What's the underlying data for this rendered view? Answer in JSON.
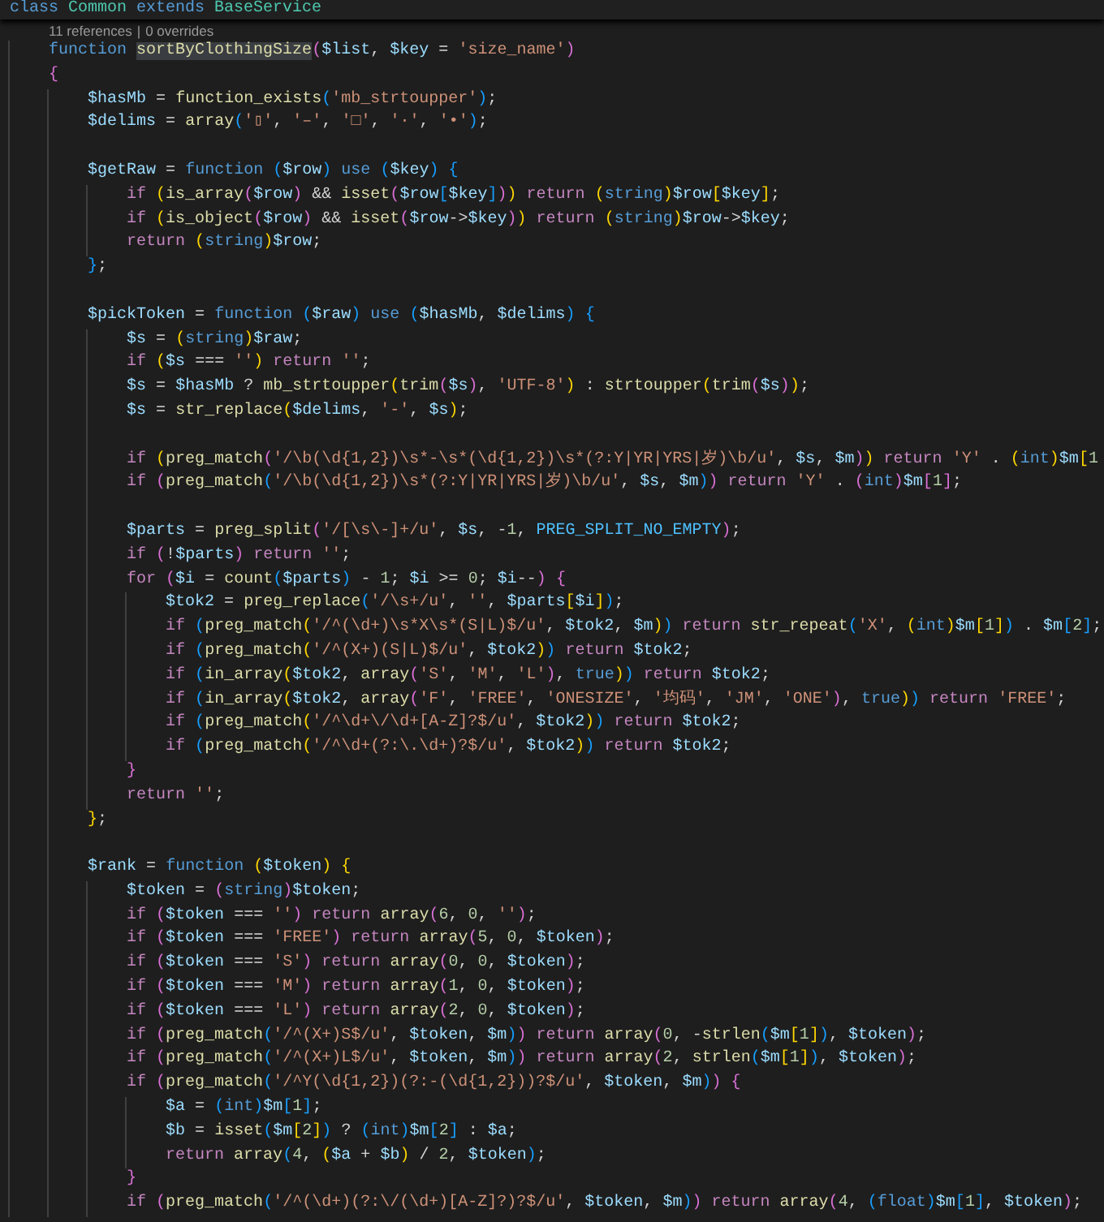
{
  "sticky_header": {
    "segments": [
      {
        "kind": "storage",
        "text": "class"
      },
      {
        "kind": "class",
        "text": " Common"
      },
      {
        "kind": "storage",
        "text": " extends"
      },
      {
        "kind": "class",
        "text": " BaseService"
      }
    ]
  },
  "codelens": {
    "references": "11 references",
    "separator": "|",
    "overrides": "0 overrides"
  },
  "lines": [
    {
      "blank_before": false,
      "segments": [
        {
          "kind": "storage",
          "text": "    function"
        },
        {
          "kind": "selection",
          "text": " sortByClothingSize"
        },
        {
          "kind": "code",
          "text": "($list, $key = 'size_name')"
        }
      ]
    },
    {
      "blank_before": false,
      "segments": [
        {
          "kind": "code",
          "text": "    {"
        }
      ]
    },
    {
      "blank_before": false,
      "segments": [
        {
          "kind": "code",
          "text": "        $hasMb = function_exists('mb_strtoupper');"
        }
      ]
    },
    {
      "blank_before": false,
      "segments": [
        {
          "kind": "code",
          "text": "        $delims = array('▯', '–', '□', '·', '•');"
        }
      ]
    },
    {
      "blank_before": true,
      "segments": [
        {
          "kind": "code",
          "text": "        $getRaw = "
        },
        {
          "kind": "storage",
          "text": "function"
        },
        {
          "kind": "code",
          "text": " ($row) "
        },
        {
          "kind": "storage",
          "text": "use"
        },
        {
          "kind": "code",
          "text": " ($key) {"
        }
      ]
    },
    {
      "blank_before": false,
      "segments": [
        {
          "kind": "control",
          "text": "            if"
        },
        {
          "kind": "code",
          "text": " (is_array($row) && isset($row[$key])) "
        },
        {
          "kind": "control",
          "text": "return"
        },
        {
          "kind": "code",
          "text": " (string)$row[$key];"
        }
      ]
    },
    {
      "blank_before": false,
      "segments": [
        {
          "kind": "control",
          "text": "            if"
        },
        {
          "kind": "code",
          "text": " (is_object($row) && isset($row->$key)) "
        },
        {
          "kind": "control",
          "text": "return"
        },
        {
          "kind": "code",
          "text": " (string)$row->$key;"
        }
      ]
    },
    {
      "blank_before": false,
      "segments": [
        {
          "kind": "control",
          "text": "            return"
        },
        {
          "kind": "code",
          "text": " (string)$row;"
        }
      ]
    },
    {
      "blank_before": false,
      "segments": [
        {
          "kind": "code",
          "text": "        };"
        }
      ]
    },
    {
      "blank_before": true,
      "segments": [
        {
          "kind": "code",
          "text": "        $pickToken = "
        },
        {
          "kind": "storage",
          "text": "function"
        },
        {
          "kind": "code",
          "text": " ($raw) "
        },
        {
          "kind": "storage",
          "text": "use"
        },
        {
          "kind": "code",
          "text": " ($hasMb, $delims) {"
        }
      ]
    },
    {
      "blank_before": false,
      "segments": [
        {
          "kind": "code",
          "text": "            $s = (string)$raw;"
        }
      ]
    },
    {
      "blank_before": false,
      "segments": [
        {
          "kind": "control",
          "text": "            if"
        },
        {
          "kind": "code",
          "text": " ($s === '') "
        },
        {
          "kind": "control",
          "text": "return"
        },
        {
          "kind": "code",
          "text": " '';"
        }
      ]
    },
    {
      "blank_before": false,
      "segments": [
        {
          "kind": "code",
          "text": "            $s = $hasMb ? mb_strtoupper(trim($s), 'UTF-8') : strtoupper(trim($s));"
        }
      ]
    },
    {
      "blank_before": false,
      "segments": [
        {
          "kind": "code",
          "text": "            $s = str_replace($delims, '-', $s);"
        }
      ]
    },
    {
      "blank_before": true,
      "segments": [
        {
          "kind": "control",
          "text": "            if"
        },
        {
          "kind": "code",
          "text": " (preg_match('/\\b(\\d{1,2})\\s*-\\s*(\\d{1,2})\\s*(?:Y|YR|YRS|岁)\\b/u', $s, $m)) "
        },
        {
          "kind": "control",
          "text": "return"
        },
        {
          "kind": "code",
          "text": " 'Y' . (int)$m[1"
        }
      ]
    },
    {
      "blank_before": false,
      "segments": [
        {
          "kind": "control",
          "text": "            if"
        },
        {
          "kind": "code",
          "text": " (preg_match('/\\b(\\d{1,2})\\s*(?:Y|YR|YRS|岁)\\b/u', $s, $m)) "
        },
        {
          "kind": "control",
          "text": "return"
        },
        {
          "kind": "code",
          "text": " 'Y' . (int)$m[1];"
        }
      ]
    },
    {
      "blank_before": true,
      "segments": [
        {
          "kind": "code",
          "text": "            $parts = preg_split('/[\\s\\-]+/u', $s, -1, PREG_SPLIT_NO_EMPTY);"
        }
      ]
    },
    {
      "blank_before": false,
      "segments": [
        {
          "kind": "control",
          "text": "            if"
        },
        {
          "kind": "code",
          "text": " (!$parts) "
        },
        {
          "kind": "control",
          "text": "return"
        },
        {
          "kind": "code",
          "text": " '';"
        }
      ]
    },
    {
      "blank_before": false,
      "segments": [
        {
          "kind": "control",
          "text": "            for"
        },
        {
          "kind": "code",
          "text": " ($i = count($parts) - 1; $i >= 0; $i--) {"
        }
      ]
    },
    {
      "blank_before": false,
      "segments": [
        {
          "kind": "code",
          "text": "                $tok2 = preg_replace('/\\s+/u', '', $parts[$i]);"
        }
      ]
    },
    {
      "blank_before": false,
      "segments": [
        {
          "kind": "control",
          "text": "                if"
        },
        {
          "kind": "code",
          "text": " (preg_match('/^(\\d+)\\s*X\\s*(S|L)$/u', $tok2, $m)) "
        },
        {
          "kind": "control",
          "text": "return"
        },
        {
          "kind": "code",
          "text": " str_repeat('X', (int)$m[1]) . $m[2];"
        }
      ]
    },
    {
      "blank_before": false,
      "segments": [
        {
          "kind": "control",
          "text": "                if"
        },
        {
          "kind": "code",
          "text": " (preg_match('/^(X+)(S|L)$/u', $tok2)) "
        },
        {
          "kind": "control",
          "text": "return"
        },
        {
          "kind": "code",
          "text": " $tok2;"
        }
      ]
    },
    {
      "blank_before": false,
      "segments": [
        {
          "kind": "control",
          "text": "                if"
        },
        {
          "kind": "code",
          "text": " (in_array($tok2, array('S', 'M', 'L'), "
        },
        {
          "kind": "storage",
          "text": "true"
        },
        {
          "kind": "code",
          "text": ")) "
        },
        {
          "kind": "control",
          "text": "return"
        },
        {
          "kind": "code",
          "text": " $tok2;"
        }
      ]
    },
    {
      "blank_before": false,
      "segments": [
        {
          "kind": "control",
          "text": "                if"
        },
        {
          "kind": "code",
          "text": " (in_array($tok2, array('F', 'FREE', 'ONESIZE', '均码', 'JM', 'ONE'), "
        },
        {
          "kind": "storage",
          "text": "true"
        },
        {
          "kind": "code",
          "text": ")) "
        },
        {
          "kind": "control",
          "text": "return"
        },
        {
          "kind": "code",
          "text": " 'FREE';"
        }
      ]
    },
    {
      "blank_before": false,
      "segments": [
        {
          "kind": "control",
          "text": "                if"
        },
        {
          "kind": "code",
          "text": " (preg_match('/^\\d+\\/\\d+[A-Z]?$/u', $tok2)) "
        },
        {
          "kind": "control",
          "text": "return"
        },
        {
          "kind": "code",
          "text": " $tok2;"
        }
      ]
    },
    {
      "blank_before": false,
      "segments": [
        {
          "kind": "control",
          "text": "                if"
        },
        {
          "kind": "code",
          "text": " (preg_match('/^\\d+(?:\\.\\d+)?$/u', $tok2)) "
        },
        {
          "kind": "control",
          "text": "return"
        },
        {
          "kind": "code",
          "text": " $tok2;"
        }
      ]
    },
    {
      "blank_before": false,
      "segments": [
        {
          "kind": "code",
          "text": "            }"
        }
      ]
    },
    {
      "blank_before": false,
      "segments": [
        {
          "kind": "control",
          "text": "            return"
        },
        {
          "kind": "code",
          "text": " '';"
        }
      ]
    },
    {
      "blank_before": false,
      "segments": [
        {
          "kind": "code",
          "text": "        };"
        }
      ]
    },
    {
      "blank_before": true,
      "segments": [
        {
          "kind": "code",
          "text": "        $rank = "
        },
        {
          "kind": "storage",
          "text": "function"
        },
        {
          "kind": "code",
          "text": " ($token) {"
        }
      ]
    },
    {
      "blank_before": false,
      "segments": [
        {
          "kind": "code",
          "text": "            $token = (string)$token;"
        }
      ]
    },
    {
      "blank_before": false,
      "segments": [
        {
          "kind": "control",
          "text": "            if"
        },
        {
          "kind": "code",
          "text": " ($token === '') "
        },
        {
          "kind": "control",
          "text": "return"
        },
        {
          "kind": "code",
          "text": " array(6, 0, '');"
        }
      ]
    },
    {
      "blank_before": false,
      "segments": [
        {
          "kind": "control",
          "text": "            if"
        },
        {
          "kind": "code",
          "text": " ($token === 'FREE') "
        },
        {
          "kind": "control",
          "text": "return"
        },
        {
          "kind": "code",
          "text": " array(5, 0, $token);"
        }
      ]
    },
    {
      "blank_before": false,
      "segments": [
        {
          "kind": "control",
          "text": "            if"
        },
        {
          "kind": "code",
          "text": " ($token === 'S') "
        },
        {
          "kind": "control",
          "text": "return"
        },
        {
          "kind": "code",
          "text": " array(0, 0, $token);"
        }
      ]
    },
    {
      "blank_before": false,
      "segments": [
        {
          "kind": "control",
          "text": "            if"
        },
        {
          "kind": "code",
          "text": " ($token === 'M') "
        },
        {
          "kind": "control",
          "text": "return"
        },
        {
          "kind": "code",
          "text": " array(1, 0, $token);"
        }
      ]
    },
    {
      "blank_before": false,
      "segments": [
        {
          "kind": "control",
          "text": "            if"
        },
        {
          "kind": "code",
          "text": " ($token === 'L') "
        },
        {
          "kind": "control",
          "text": "return"
        },
        {
          "kind": "code",
          "text": " array(2, 0, $token);"
        }
      ]
    },
    {
      "blank_before": false,
      "segments": [
        {
          "kind": "control",
          "text": "            if"
        },
        {
          "kind": "code",
          "text": " (preg_match('/^(X+)S$/u', $token, $m)) "
        },
        {
          "kind": "control",
          "text": "return"
        },
        {
          "kind": "code",
          "text": " array(0, -strlen($m[1]), $token);"
        }
      ]
    },
    {
      "blank_before": false,
      "segments": [
        {
          "kind": "control",
          "text": "            if"
        },
        {
          "kind": "code",
          "text": " (preg_match('/^(X+)L$/u', $token, $m)) "
        },
        {
          "kind": "control",
          "text": "return"
        },
        {
          "kind": "code",
          "text": " array(2, strlen($m[1]), $token);"
        }
      ]
    },
    {
      "blank_before": false,
      "segments": [
        {
          "kind": "control",
          "text": "            if"
        },
        {
          "kind": "code",
          "text": " (preg_match('/^Y(\\d{1,2})(?:-(\\d{1,2}))?$/u', $token, $m)) {"
        }
      ]
    },
    {
      "blank_before": false,
      "segments": [
        {
          "kind": "code",
          "text": "                $a = (int)$m[1];"
        }
      ]
    },
    {
      "blank_before": false,
      "segments": [
        {
          "kind": "code",
          "text": "                $b = isset($m[2]) ? (int)$m[2] : $a;"
        }
      ]
    },
    {
      "blank_before": false,
      "segments": [
        {
          "kind": "control",
          "text": "                return"
        },
        {
          "kind": "code",
          "text": " array(4, ($a + $b) / 2, $token);"
        }
      ]
    },
    {
      "blank_before": false,
      "segments": [
        {
          "kind": "code",
          "text": "            }"
        }
      ]
    },
    {
      "blank_before": false,
      "segments": [
        {
          "kind": "control",
          "text": "            if"
        },
        {
          "kind": "code",
          "text": " (preg_match('/^(\\d+)(?:\\/(\\d+)[A-Z]?)?$/u', $token, $m)) "
        },
        {
          "kind": "control",
          "text": "return"
        },
        {
          "kind": "code",
          "text": " array(4, (float)$m[1], $token);"
        }
      ]
    }
  ]
}
